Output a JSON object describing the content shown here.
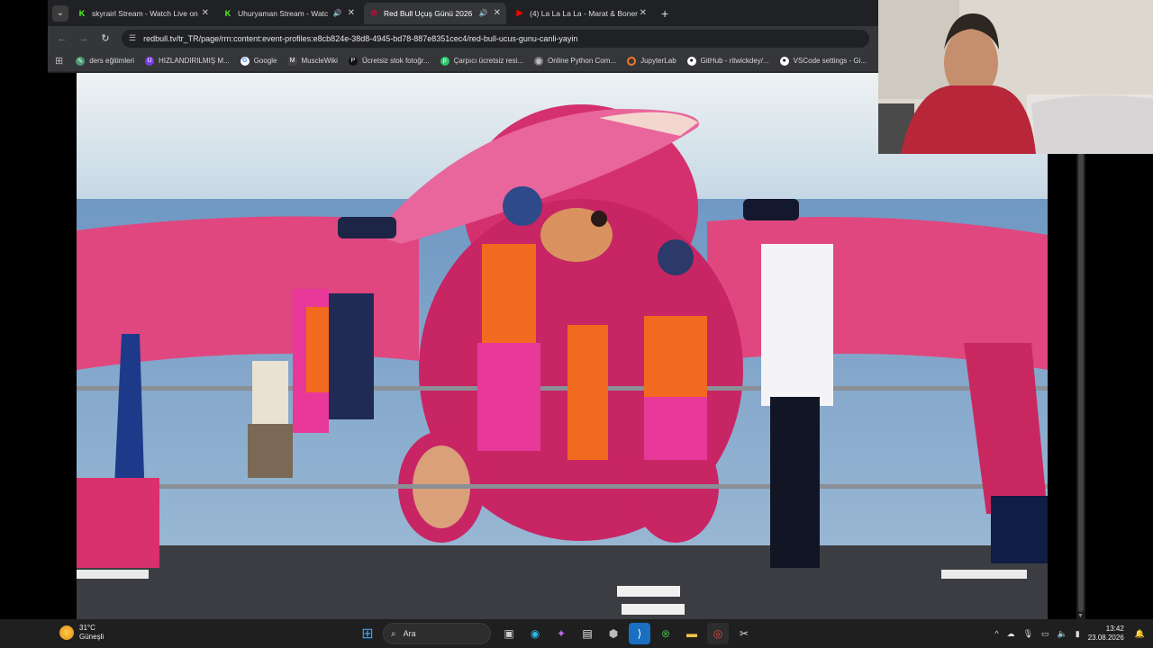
{
  "browser": {
    "tabs": [
      {
        "title": "skyrairl Stream - Watch Live on",
        "icon": "kick-icon",
        "color": "#53fc18",
        "active": false,
        "sound": false
      },
      {
        "title": "Uhuryaman Stream - Watch",
        "icon": "kick-icon",
        "color": "#53fc18",
        "active": false,
        "sound": true
      },
      {
        "title": "Red Bull Uçuş Günü 2026 |",
        "icon": "redbull-icon",
        "color": "#e4002b",
        "active": true,
        "sound": true
      },
      {
        "title": "(4) La La La La - Marat & Boner",
        "icon": "youtube-icon",
        "color": "#ff0000",
        "active": false,
        "sound": false
      }
    ],
    "url": "redbull.tv/tr_TR/page/rrn:content:event-profiles:e8cb824e-38d8-4945-bd78-887e8351cec4/red-bull-ucus-gunu-canli-yayin",
    "bookmarks": [
      {
        "label": "ders eğitimleri",
        "icon": "leaf-icon",
        "color": "#4a9b6f"
      },
      {
        "label": "HIZLANDIRILMIŞ M...",
        "icon": "course-icon",
        "color": "#7b3fe4"
      },
      {
        "label": "Google",
        "icon": "google-icon",
        "color": "#4285f4"
      },
      {
        "label": "MuscleWiki",
        "icon": "musclewiki-icon",
        "color": "#444444"
      },
      {
        "label": "Ücretsiz stok fotoğr...",
        "icon": "pexels-icon",
        "color": "#05a081"
      },
      {
        "label": "Çarpıcı ücretsiz resi...",
        "icon": "pixabay-icon",
        "color": "#2ec66d"
      },
      {
        "label": "Online Python Com...",
        "icon": "globe-icon",
        "color": "#777777"
      },
      {
        "label": "JupyterLab",
        "icon": "jupyter-icon",
        "color": "#f37726"
      },
      {
        "label": "GitHub - ritwickdey/...",
        "icon": "github-icon",
        "color": "#333333"
      },
      {
        "label": "VSCode settings - Gi...",
        "icon": "github-icon",
        "color": "#333333"
      }
    ]
  },
  "taskbar": {
    "weather_temp": "31°C",
    "weather_desc": "Güneşli",
    "search_label": "Ara",
    "time": "13:42",
    "date": "23.08.2026"
  }
}
